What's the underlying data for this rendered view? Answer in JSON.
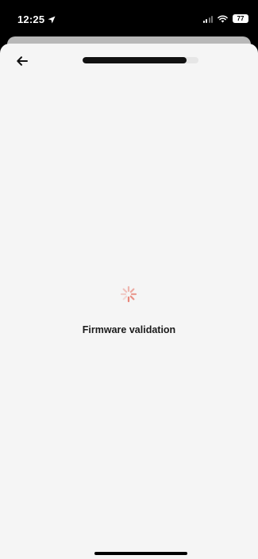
{
  "status_bar": {
    "time": "12:25",
    "battery": "77",
    "icons": [
      "location-arrow-icon",
      "signal-icon",
      "wifi-icon",
      "battery-icon"
    ]
  },
  "header": {
    "back_icon": "arrow-left-icon",
    "progress": 0.9
  },
  "content": {
    "spinner_icon": "loading-spinner-icon",
    "status_text": "Firmware validation"
  },
  "colors": {
    "accent": "#e8867a",
    "background": "#f5f5f5",
    "text": "#1a1a1a"
  }
}
